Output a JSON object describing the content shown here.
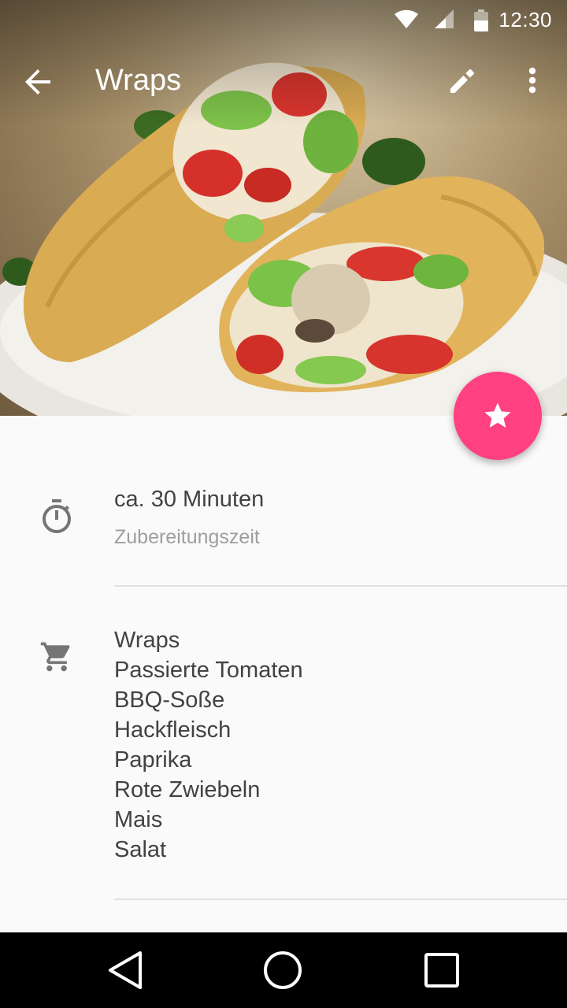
{
  "status_bar": {
    "time": "12:30",
    "icons": [
      "wifi-icon",
      "cell-signal-icon",
      "battery-icon"
    ]
  },
  "toolbar": {
    "title": "Wraps",
    "icons": [
      "arrow-back-icon",
      "pencil-edit-icon",
      "more-vert-icon"
    ]
  },
  "hero": {
    "subject": "wraps-photo"
  },
  "fab": {
    "icon": "star-icon",
    "color": "#ff4081"
  },
  "prep_time": {
    "icon": "timer-icon",
    "value": "ca. 30 Minuten",
    "label": "Zubereitungszeit"
  },
  "ingredients": {
    "icon": "shopping-cart-icon",
    "items": [
      "Wraps",
      "Passierte Tomaten",
      "BBQ-Soße",
      "Hackfleisch",
      "Paprika",
      "Rote Zwiebeln",
      "Mais",
      "Salat"
    ]
  },
  "nav_bar": {
    "icons": [
      "nav-back-icon",
      "nav-home-icon",
      "nav-recents-icon"
    ]
  }
}
